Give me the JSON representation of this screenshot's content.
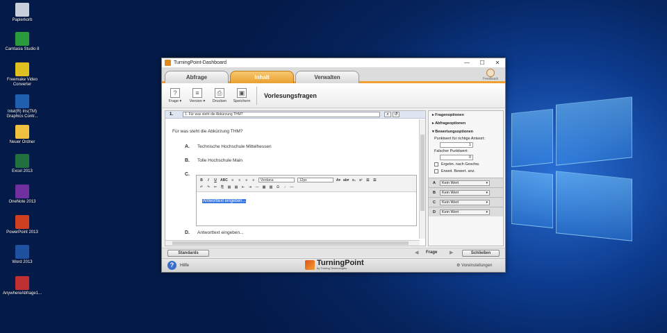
{
  "desktop_icons": [
    {
      "label": "Papierkorb",
      "color": "#c8d0dc"
    },
    {
      "label": "Camtasia Studio 8",
      "color": "#2a9a3a"
    },
    {
      "label": "Freemake Video Converter",
      "color": "#e0c020"
    },
    {
      "label": "Intel(R) Iris(TM) Graphics Contr...",
      "color": "#2060b0"
    },
    {
      "label": "Neuer Ordner",
      "color": "#f0c040"
    },
    {
      "label": "Excel 2013",
      "color": "#207040"
    },
    {
      "label": "OneNote 2013",
      "color": "#7030a0"
    },
    {
      "label": "PowerPoint 2013",
      "color": "#d04020"
    },
    {
      "label": "Word 2013",
      "color": "#2050a0"
    },
    {
      "label": "AnywhereAbfrage1...",
      "color": "#c03030"
    }
  ],
  "window": {
    "title": "TurningPoint-Dashboard",
    "minimize": "—",
    "maximize": "☐",
    "close": "✕"
  },
  "tabs": [
    {
      "label": "Abfrage"
    },
    {
      "label": "Inhalt"
    },
    {
      "label": "Verwalten"
    }
  ],
  "feedback_label": "Feedback",
  "toolbar": {
    "frage": "Frage",
    "version": "Version",
    "drucken": "Drucken",
    "speichern": "Speichern",
    "title": "Vorlesungsfragen"
  },
  "question": {
    "number": "1.",
    "selector": "1. Für was steht die Abkürzung THM?",
    "text": "Für was steht die Abkürzung THM?",
    "answers": [
      {
        "letter": "A.",
        "text": "Technische Hochschule Mittelhessen"
      },
      {
        "letter": "B.",
        "text": "Tolle Hochschule Main"
      },
      {
        "letter": "C.",
        "text": ""
      },
      {
        "letter": "D.",
        "text": "Antworttext eingeben..."
      }
    ],
    "editor_text": "Antworttext eingeben...",
    "font": "Verdana",
    "size": "12px"
  },
  "options": {
    "fragenoptionen": "▸ Fragenoptionen",
    "abfrageoptionen": "▸ Abfrageoptionen",
    "bewertungsoptionen": "▾ Bewertungsoptionen",
    "punktwert_label": "Punktwert für richtige Antwort:",
    "punktwert": "1",
    "falsch_label": "Falscher Punktwert:",
    "falsch": "0",
    "ergebn": "Ergebn. nach Geschw.",
    "erweit": "Erweit. Bewert. anz.",
    "answer_rows": [
      {
        "letter": "A",
        "value": "Kein Wert"
      },
      {
        "letter": "B",
        "value": "Kein Wert"
      },
      {
        "letter": "C",
        "value": "Kein Wert"
      },
      {
        "letter": "D",
        "value": "Kein Wert"
      }
    ]
  },
  "bottom": {
    "standards": "Standards",
    "frage": "Frage",
    "schliessen": "Schließen"
  },
  "footer": {
    "hilfe": "Hilfe",
    "brand": "TurningPoint",
    "brand_sub": "by Turning Technologies",
    "voreinstellungen": "Voreinstellungen"
  }
}
